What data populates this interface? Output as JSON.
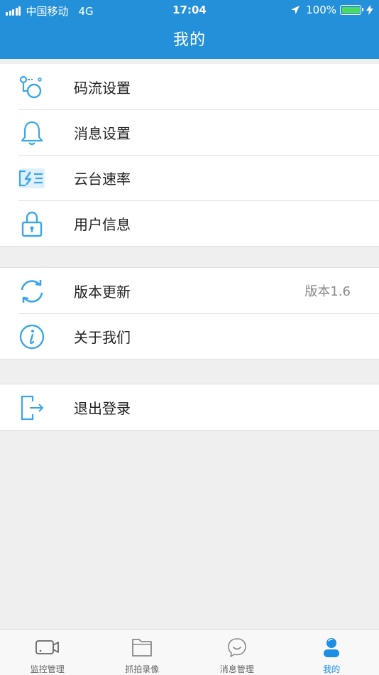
{
  "status_bar": {
    "carrier": "中国移动",
    "network": "4G",
    "time": "17:04",
    "battery": "100%"
  },
  "header": {
    "title": "我的"
  },
  "groups": [
    {
      "items": [
        {
          "label": "码流设置",
          "icon": "stream-icon"
        },
        {
          "label": "消息设置",
          "icon": "bell-icon"
        },
        {
          "label": "云台速率",
          "icon": "speed-icon"
        },
        {
          "label": "用户信息",
          "icon": "lock-icon"
        }
      ]
    },
    {
      "items": [
        {
          "label": "版本更新",
          "icon": "refresh-icon",
          "value": "版本1.6"
        },
        {
          "label": "关于我们",
          "icon": "info-icon"
        }
      ]
    },
    {
      "items": [
        {
          "label": "退出登录",
          "icon": "logout-icon"
        }
      ]
    }
  ],
  "tabbar": {
    "tabs": [
      {
        "label": "监控管理",
        "icon": "camera-icon"
      },
      {
        "label": "抓拍录像",
        "icon": "folder-icon"
      },
      {
        "label": "消息管理",
        "icon": "chat-icon"
      },
      {
        "label": "我的",
        "icon": "user-icon",
        "active": true
      }
    ]
  },
  "colors": {
    "header": "#2390d9",
    "icon": "#3aa6e8",
    "active_tab": "#1d8ee6",
    "background": "#efefef"
  }
}
